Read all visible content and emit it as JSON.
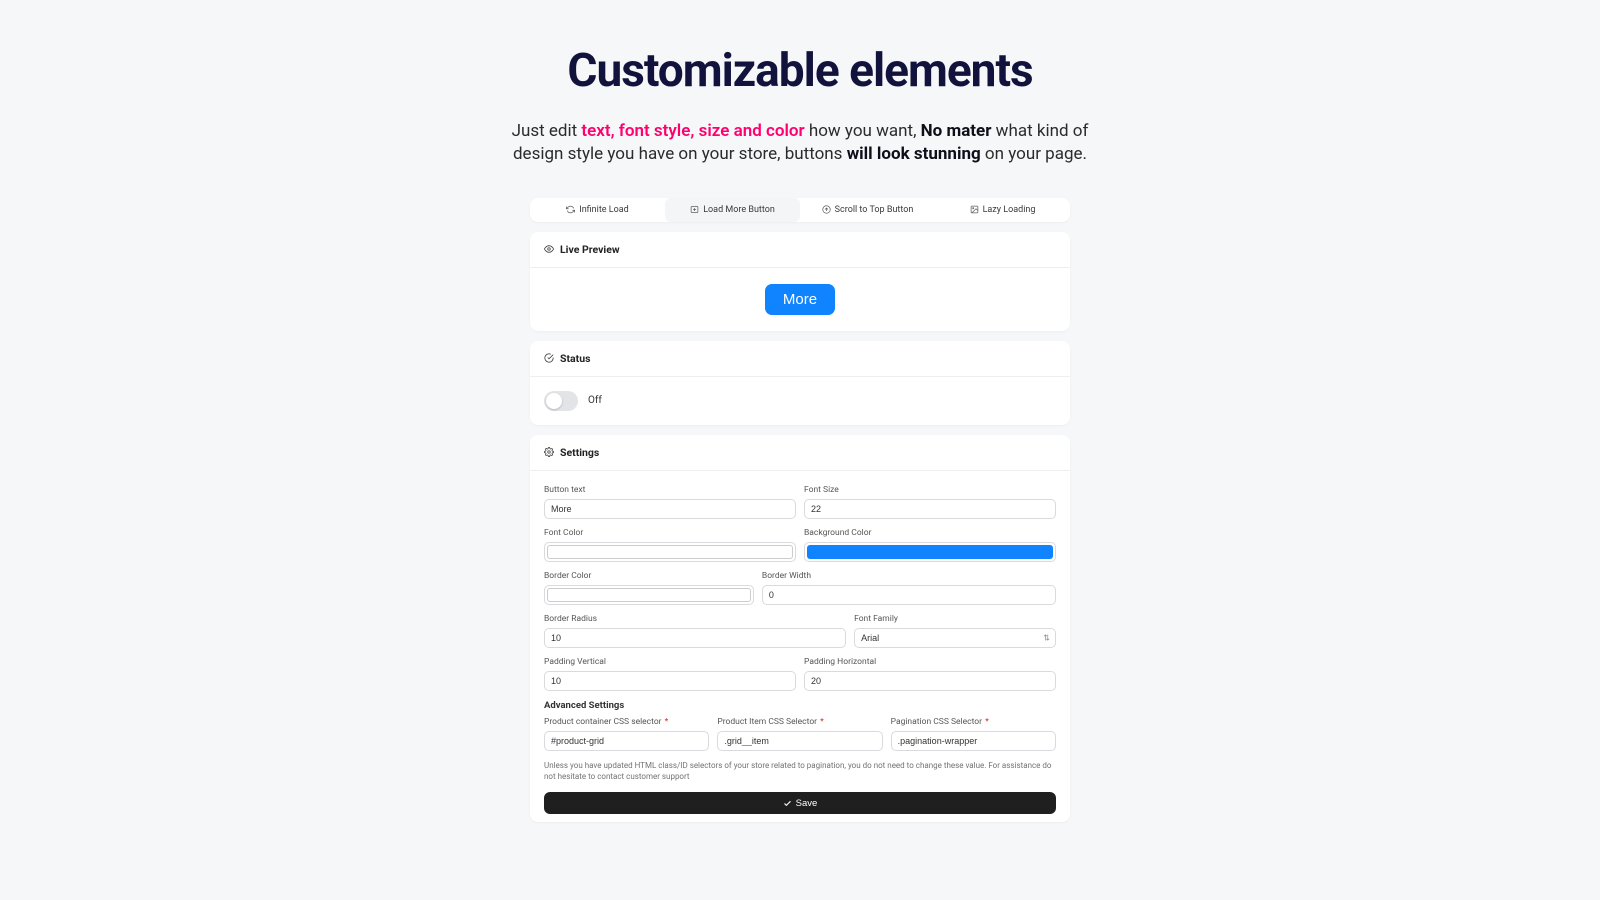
{
  "title": "Customizable elements",
  "subtitle": {
    "pre": "Just edit ",
    "highlight": "text, font style, size and color",
    "mid": " how you want, ",
    "bold1": "No mater",
    "mid2": " what kind of design style you have on your store, buttons ",
    "bold2": "will look stunning",
    "post": " on your page."
  },
  "tabs": {
    "infinite": "Infinite Load",
    "loadmore": "Load More Button",
    "scrolltop": "Scroll to Top Button",
    "lazy": "Lazy Loading"
  },
  "sections": {
    "preview": "Live Preview",
    "status": "Status",
    "settings": "Settings"
  },
  "preview_button": "More",
  "status": {
    "label": "Off"
  },
  "fields": {
    "button_text": {
      "label": "Button text",
      "value": "More"
    },
    "font_size": {
      "label": "Font Size",
      "value": "22"
    },
    "font_color": {
      "label": "Font Color",
      "value": "#ffffff"
    },
    "bg_color": {
      "label": "Background Color",
      "value": "#1084ff"
    },
    "border_color": {
      "label": "Border Color",
      "value": "#ffffff"
    },
    "border_width": {
      "label": "Border Width",
      "value": "0"
    },
    "border_radius": {
      "label": "Border Radius",
      "value": "10"
    },
    "font_family": {
      "label": "Font Family",
      "value": "Arial"
    },
    "pad_v": {
      "label": "Padding Vertical",
      "value": "10"
    },
    "pad_h": {
      "label": "Padding Horizontal",
      "value": "20"
    }
  },
  "advanced": {
    "heading": "Advanced Settings",
    "product_container": {
      "label": "Product container CSS selector",
      "value": "#product-grid"
    },
    "product_item": {
      "label": "Product Item CSS Selector",
      "value": ".grid__item"
    },
    "pagination": {
      "label": "Pagination CSS Selector",
      "value": ".pagination-wrapper"
    },
    "hint": "Unless you have updated HTML class/ID selectors of your store related to pagination, you do not need to change these value. For assistance do not hesitate to contact customer support"
  },
  "save": "Save"
}
